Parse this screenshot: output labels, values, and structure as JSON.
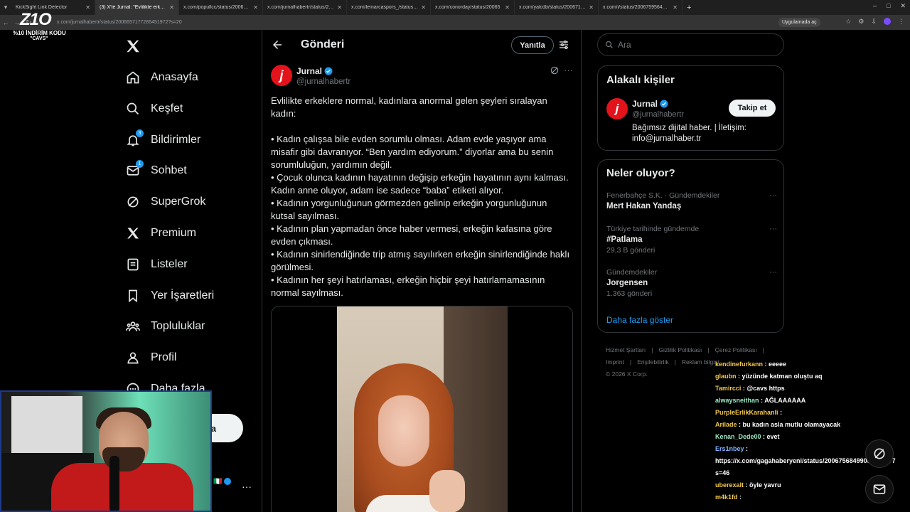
{
  "browser": {
    "tabs": [
      {
        "title": "KickSight Link Detector",
        "active": false
      },
      {
        "title": "(3) X'te Jurnal: \"Evlilikte erkekle",
        "active": true
      },
      {
        "title": "x.com/popullcc/status/20067408",
        "active": false
      },
      {
        "title": "x.com/jurnalhabertr/status/2006",
        "active": false
      },
      {
        "title": "x.com/lemarcaspors_/status/20",
        "active": false
      },
      {
        "title": "x.com/conorday/status/20065",
        "active": false
      },
      {
        "title": "x.com/yalcdb/status/200671718",
        "active": false
      },
      {
        "title": "x.com/i/status/20067595640042",
        "active": false
      }
    ],
    "url": "x.com/jurnalhabertr/status/2006657177285451972?s=20",
    "open_in_app": "Uygulamada aç"
  },
  "overlay": {
    "logo_text": "Z1O",
    "promo_line1": "%10 İNDİRİM KODU",
    "promo_line2": "\"CAVS\""
  },
  "nav": {
    "items": [
      {
        "label": "Anasayfa",
        "icon": "home-icon",
        "badge": ""
      },
      {
        "label": "Keşfet",
        "icon": "search-icon",
        "badge": ""
      },
      {
        "label": "Bildirimler",
        "icon": "bell-icon",
        "badge": "3"
      },
      {
        "label": "Sohbet",
        "icon": "mail-icon",
        "badge": "1"
      },
      {
        "label": "SuperGrok",
        "icon": "grok-icon",
        "badge": ""
      },
      {
        "label": "Premium",
        "icon": "x-icon",
        "badge": ""
      },
      {
        "label": "Listeler",
        "icon": "list-icon",
        "badge": ""
      },
      {
        "label": "Yer İşaretleri",
        "icon": "bookmark-icon",
        "badge": ""
      },
      {
        "label": "Topluluklar",
        "icon": "communities-icon",
        "badge": ""
      },
      {
        "label": "Profil",
        "icon": "profile-icon",
        "badge": ""
      },
      {
        "label": "Daha fazla",
        "icon": "more-circle-icon",
        "badge": ""
      }
    ],
    "post_button": "a"
  },
  "main": {
    "header_title": "Gönderi",
    "reply_button": "Yanıtla",
    "author_name": "Jurnal",
    "author_handle": "@jurnalhabertr",
    "text_intro": "Evlilikte erkeklere normal, kadınlara anormal gelen şeyleri sıralayan kadın:",
    "bullets": [
      "• Kadın çalışsa bile evden sorumlu olması. Adam evde yaşıyor ama misafir gibi davranıyor. “Ben yardım ediyorum.” diyorlar ama bu senin sorumluluğun, yardımın değil.",
      "• Çocuk olunca kadının hayatının değişip erkeğin hayatının aynı kalması. Kadın anne oluyor, adam ise sadece “baba” etiketi alıyor.",
      "• Kadının yorgunluğunun görmezden gelinip erkeğin yorgunluğunun kutsal sayılması.",
      "• Kadının plan yapmadan önce haber vermesi, erkeğin kafasına göre evden çıkması.",
      "• Kadının sinirlendiğinde trip atmış sayılırken erkeğin sinirlendiğinde haklı görülmesi.",
      "• Kadının her şeyi hatırlaması, erkeğin hiçbir şeyi hatırlamamasının normal sayılması."
    ]
  },
  "sidebar": {
    "search_placeholder": "Ara",
    "related_title": "Alakalı kişiler",
    "related": {
      "name": "Jurnal",
      "handle": "@jurnalhabertr",
      "follow": "Takip et",
      "bio": "Bağımsız dijital haber. | İletişim: info@jurnalhaber.tr"
    },
    "trending_title": "Neler oluyor?",
    "trends": [
      {
        "context": "Fenerbahçe S.K. · Gündemdekiler",
        "name": "Mert Hakan Yandaş",
        "count": ""
      },
      {
        "context": "Türkiye tarihinde gündemde",
        "name": "#Patlama",
        "count": "29,3 B gönderi"
      },
      {
        "context": "Gündemdekiler",
        "name": "Jorgensen",
        "count": "1.363 gönderi"
      }
    ],
    "show_more": "Daha fazla göster",
    "footer": [
      "Hizmet Şartları",
      "|",
      "Gizlilik Politikası",
      "|",
      "Çerez Politikası",
      "|",
      "Imprint",
      "|",
      "Erişilebilirlik",
      "|",
      "Reklam bilgisi",
      "© 2026 X Corp."
    ]
  },
  "chat": [
    {
      "user": "kendinefurkann",
      "msg": ": eeeee",
      "color": "#f2c94c"
    },
    {
      "user": "glaubn",
      "msg": ": yüzünde katman oluştu aq",
      "color": "#f2c94c"
    },
    {
      "user": "Tamircci",
      "msg": ": @cavs https",
      "color": "#f2c94c"
    },
    {
      "user": "alwaysneithan",
      "msg": ": AĞLAAAAAA",
      "color": "#9be7c4"
    },
    {
      "user": "PurpleErlikKarahanli",
      "msg": ":",
      "color": "#f2c94c"
    },
    {
      "user": "Arilade",
      "msg": ": bu kadın asla mutlu olamayacak",
      "color": "#f2c94c"
    },
    {
      "user": "Kenan_Dede00",
      "msg": ": evet",
      "color": "#9be7c4"
    },
    {
      "user": "Ers1nbey",
      "msg": ":",
      "color": "#7fb3ff"
    },
    {
      "user": "",
      "msg": "https://x.com/gagahaberyeni/status/20067568499081258577",
      "color": "#ffffff"
    },
    {
      "user": "",
      "msg": "s=46",
      "color": "#ffffff"
    },
    {
      "user": "uberexalt",
      "msg": ": öyle yavru",
      "color": "#f2c94c"
    },
    {
      "user": "m4k1fd",
      "msg": ":",
      "color": "#f2c94c"
    }
  ]
}
